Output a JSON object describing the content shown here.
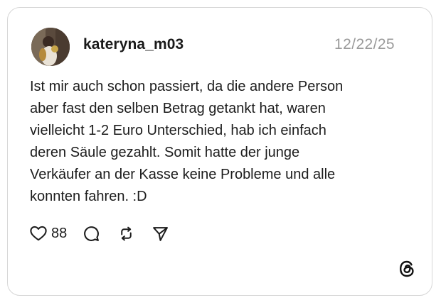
{
  "post": {
    "username": "kateryna_m03",
    "date": "12/22/25",
    "text": "Ist mir auch schon passiert, da die andere Person\naber fast den selben Betrag getankt hat, waren\nvielleicht 1-2 Euro Unterschied, hab ich einfach\nderen Säule gezahlt. Somit hatte der junge\nVerkäufer an der Kasse keine Probleme und alle\nkonnten fahren. :D",
    "like_count": "88"
  },
  "icons": {
    "like": "heart-icon",
    "reply": "speech-bubble-icon",
    "repost": "repost-icon",
    "share": "paper-plane-icon",
    "brand": "threads-logo"
  },
  "colors": {
    "text": "#1c1c1c",
    "muted": "#9a9a9a",
    "border": "#d6d6d6"
  }
}
